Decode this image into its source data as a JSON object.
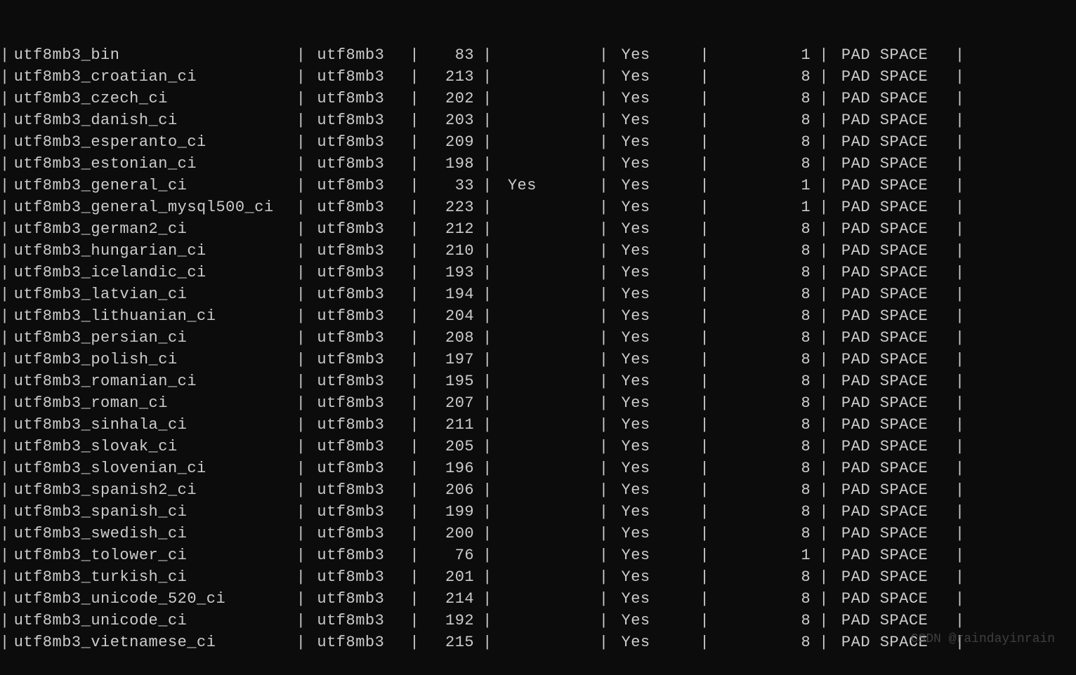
{
  "table": {
    "rows": [
      {
        "collation": "utf8mb3_bin",
        "charset": "utf8mb3",
        "id": "83",
        "default": "",
        "compiled": "Yes",
        "sortlen": "1",
        "pad": "PAD SPACE"
      },
      {
        "collation": "utf8mb3_croatian_ci",
        "charset": "utf8mb3",
        "id": "213",
        "default": "",
        "compiled": "Yes",
        "sortlen": "8",
        "pad": "PAD SPACE"
      },
      {
        "collation": "utf8mb3_czech_ci",
        "charset": "utf8mb3",
        "id": "202",
        "default": "",
        "compiled": "Yes",
        "sortlen": "8",
        "pad": "PAD SPACE"
      },
      {
        "collation": "utf8mb3_danish_ci",
        "charset": "utf8mb3",
        "id": "203",
        "default": "",
        "compiled": "Yes",
        "sortlen": "8",
        "pad": "PAD SPACE"
      },
      {
        "collation": "utf8mb3_esperanto_ci",
        "charset": "utf8mb3",
        "id": "209",
        "default": "",
        "compiled": "Yes",
        "sortlen": "8",
        "pad": "PAD SPACE"
      },
      {
        "collation": "utf8mb3_estonian_ci",
        "charset": "utf8mb3",
        "id": "198",
        "default": "",
        "compiled": "Yes",
        "sortlen": "8",
        "pad": "PAD SPACE"
      },
      {
        "collation": "utf8mb3_general_ci",
        "charset": "utf8mb3",
        "id": "33",
        "default": "Yes",
        "compiled": "Yes",
        "sortlen": "1",
        "pad": "PAD SPACE"
      },
      {
        "collation": "utf8mb3_general_mysql500_ci",
        "charset": "utf8mb3",
        "id": "223",
        "default": "",
        "compiled": "Yes",
        "sortlen": "1",
        "pad": "PAD SPACE"
      },
      {
        "collation": "utf8mb3_german2_ci",
        "charset": "utf8mb3",
        "id": "212",
        "default": "",
        "compiled": "Yes",
        "sortlen": "8",
        "pad": "PAD SPACE"
      },
      {
        "collation": "utf8mb3_hungarian_ci",
        "charset": "utf8mb3",
        "id": "210",
        "default": "",
        "compiled": "Yes",
        "sortlen": "8",
        "pad": "PAD SPACE"
      },
      {
        "collation": "utf8mb3_icelandic_ci",
        "charset": "utf8mb3",
        "id": "193",
        "default": "",
        "compiled": "Yes",
        "sortlen": "8",
        "pad": "PAD SPACE"
      },
      {
        "collation": "utf8mb3_latvian_ci",
        "charset": "utf8mb3",
        "id": "194",
        "default": "",
        "compiled": "Yes",
        "sortlen": "8",
        "pad": "PAD SPACE"
      },
      {
        "collation": "utf8mb3_lithuanian_ci",
        "charset": "utf8mb3",
        "id": "204",
        "default": "",
        "compiled": "Yes",
        "sortlen": "8",
        "pad": "PAD SPACE"
      },
      {
        "collation": "utf8mb3_persian_ci",
        "charset": "utf8mb3",
        "id": "208",
        "default": "",
        "compiled": "Yes",
        "sortlen": "8",
        "pad": "PAD SPACE"
      },
      {
        "collation": "utf8mb3_polish_ci",
        "charset": "utf8mb3",
        "id": "197",
        "default": "",
        "compiled": "Yes",
        "sortlen": "8",
        "pad": "PAD SPACE"
      },
      {
        "collation": "utf8mb3_romanian_ci",
        "charset": "utf8mb3",
        "id": "195",
        "default": "",
        "compiled": "Yes",
        "sortlen": "8",
        "pad": "PAD SPACE"
      },
      {
        "collation": "utf8mb3_roman_ci",
        "charset": "utf8mb3",
        "id": "207",
        "default": "",
        "compiled": "Yes",
        "sortlen": "8",
        "pad": "PAD SPACE"
      },
      {
        "collation": "utf8mb3_sinhala_ci",
        "charset": "utf8mb3",
        "id": "211",
        "default": "",
        "compiled": "Yes",
        "sortlen": "8",
        "pad": "PAD SPACE"
      },
      {
        "collation": "utf8mb3_slovak_ci",
        "charset": "utf8mb3",
        "id": "205",
        "default": "",
        "compiled": "Yes",
        "sortlen": "8",
        "pad": "PAD SPACE"
      },
      {
        "collation": "utf8mb3_slovenian_ci",
        "charset": "utf8mb3",
        "id": "196",
        "default": "",
        "compiled": "Yes",
        "sortlen": "8",
        "pad": "PAD SPACE"
      },
      {
        "collation": "utf8mb3_spanish2_ci",
        "charset": "utf8mb3",
        "id": "206",
        "default": "",
        "compiled": "Yes",
        "sortlen": "8",
        "pad": "PAD SPACE"
      },
      {
        "collation": "utf8mb3_spanish_ci",
        "charset": "utf8mb3",
        "id": "199",
        "default": "",
        "compiled": "Yes",
        "sortlen": "8",
        "pad": "PAD SPACE"
      },
      {
        "collation": "utf8mb3_swedish_ci",
        "charset": "utf8mb3",
        "id": "200",
        "default": "",
        "compiled": "Yes",
        "sortlen": "8",
        "pad": "PAD SPACE"
      },
      {
        "collation": "utf8mb3_tolower_ci",
        "charset": "utf8mb3",
        "id": "76",
        "default": "",
        "compiled": "Yes",
        "sortlen": "1",
        "pad": "PAD SPACE"
      },
      {
        "collation": "utf8mb3_turkish_ci",
        "charset": "utf8mb3",
        "id": "201",
        "default": "",
        "compiled": "Yes",
        "sortlen": "8",
        "pad": "PAD SPACE"
      },
      {
        "collation": "utf8mb3_unicode_520_ci",
        "charset": "utf8mb3",
        "id": "214",
        "default": "",
        "compiled": "Yes",
        "sortlen": "8",
        "pad": "PAD SPACE"
      },
      {
        "collation": "utf8mb3_unicode_ci",
        "charset": "utf8mb3",
        "id": "192",
        "default": "",
        "compiled": "Yes",
        "sortlen": "8",
        "pad": "PAD SPACE"
      },
      {
        "collation": "utf8mb3_vietnamese_ci",
        "charset": "utf8mb3",
        "id": "215",
        "default": "",
        "compiled": "Yes",
        "sortlen": "8",
        "pad": "PAD SPACE"
      }
    ]
  },
  "watermark": "CSDN @raindayinrain",
  "separator": "|"
}
